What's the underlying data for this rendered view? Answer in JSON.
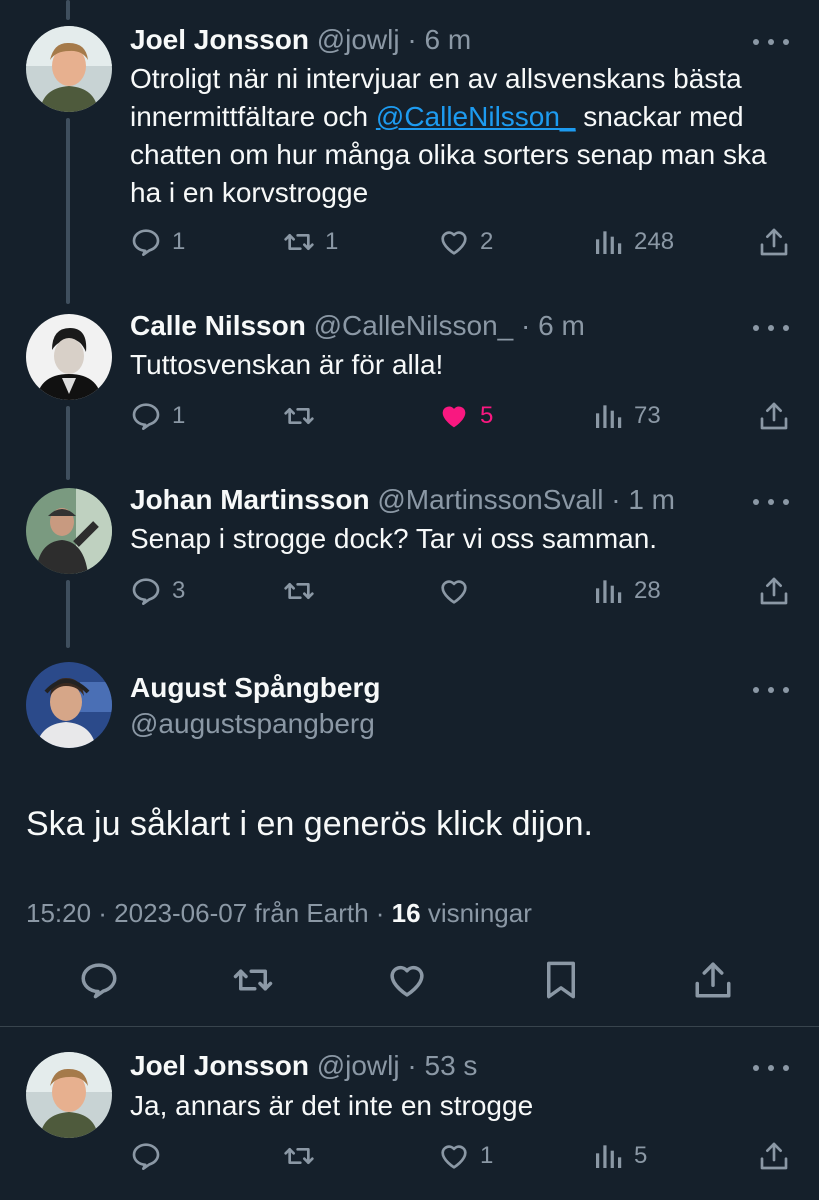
{
  "tweets": [
    {
      "name": "Joel Jonsson",
      "handle": "@jowlj",
      "time": "6 m",
      "text_before": "Otroligt när ni intervjuar en av allsvenskans bästa innermittfältare och ",
      "mention": "@CalleNilsson_",
      "text_after": " snackar med chatten om hur många olika sorters senap man ska ha i en korvstrogge",
      "replies": "1",
      "retweets": "1",
      "likes": "2",
      "views": "248"
    },
    {
      "name": "Calle Nilsson",
      "handle": "@CalleNilsson_",
      "time": "6 m",
      "text": "Tuttosvenskan är för alla!",
      "replies": "1",
      "retweets": "",
      "likes": "5",
      "views": "73"
    },
    {
      "name": "Johan Martinsson",
      "handle": "@MartinssonSvall",
      "time": "1 m",
      "text": "Senap i strogge dock? Tar vi oss samman.",
      "replies": "3",
      "retweets": "",
      "likes": "",
      "views": "28"
    }
  ],
  "main_tweet": {
    "name": "August Spångberg",
    "handle": "@augustspangberg",
    "text": "Ska ju såklart i en generös klick dijon.",
    "meta_time": "15:20 · 2023-06-07 från Earth · ",
    "views_count": "16",
    "views_label": " visningar"
  },
  "reply_tweet": {
    "name": "Joel Jonsson",
    "handle": "@jowlj",
    "time": "53 s",
    "text": "Ja, annars är det inte en strogge",
    "replies": "",
    "retweets": "",
    "likes": "1",
    "views": "5"
  },
  "colors": {
    "background": "#15202b",
    "text": "#f7f9f9",
    "secondary": "#8b98a5",
    "link": "#1d9bf0",
    "like_active": "#f91880"
  }
}
